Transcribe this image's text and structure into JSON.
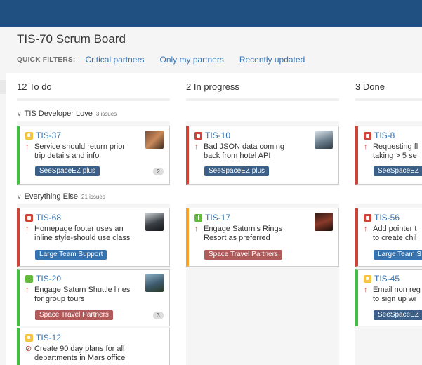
{
  "board": {
    "title": "TIS-70 Scrum Board",
    "quick_filters": {
      "label": "QUICK FILTERS:",
      "items": [
        "Critical partners",
        "Only my partners",
        "Recently updated"
      ]
    }
  },
  "columns": [
    {
      "count": "12",
      "name": "To do"
    },
    {
      "count": "2",
      "name": "In progress"
    },
    {
      "count": "3",
      "name": "Done"
    }
  ],
  "swimlanes": [
    {
      "name": "TIS Developer Love",
      "count": "3 issues"
    },
    {
      "name": "Everything Else",
      "count": "21 issues"
    }
  ],
  "cards": [
    {
      "key": "TIS-37",
      "type": "improvement-icon",
      "priority": "arrow-up-icon",
      "summary": "Service should return prior\ntrip details and info",
      "epic": "SeeSpaceEZ plus",
      "epic_color": "#3b5f86",
      "badge": "2"
    },
    {
      "key": "TIS-10",
      "type": "bug-icon",
      "priority": "arrow-up-icon",
      "summary": "Bad JSON data coming\nback from hotel API",
      "epic": "SeeSpaceEZ plus",
      "epic_color": "#3b5f86"
    },
    {
      "key": "TIS-8",
      "type": "bug-icon",
      "priority": "arrow-up-icon",
      "summary": "Requesting fl\ntaking > 5 se",
      "epic": "SeeSpaceEZ",
      "epic_color": "#3b5f86"
    },
    {
      "key": "TIS-68",
      "type": "bug-icon",
      "priority": "arrow-up-icon",
      "summary": "Homepage footer uses an\ninline style-should use class",
      "epic": "Large Team Support",
      "epic_color": "#3572b0"
    },
    {
      "key": "TIS-17",
      "type": "story-icon",
      "priority": "arrow-up-icon",
      "summary": "Engage Saturn's Rings\nResort as preferred",
      "epic": "Space Travel Partners",
      "epic_color": "#b15a5a"
    },
    {
      "key": "TIS-56",
      "type": "bug-icon",
      "priority": "arrow-up-icon",
      "summary": "Add pointer t\nto create chil",
      "epic": "Large Team S",
      "epic_color": "#3572b0"
    },
    {
      "key": "TIS-20",
      "type": "story-icon",
      "priority": "arrow-up-icon",
      "summary": "Engage Saturn Shuttle lines\nfor group tours",
      "epic": "Space Travel Partners",
      "epic_color": "#b15a5a",
      "badge": "3"
    },
    {
      "key": "TIS-45",
      "type": "improvement-icon",
      "priority": "arrow-up-icon",
      "summary": "Email non reg\nto sign up wi",
      "epic": "SeeSpaceEZ",
      "epic_color": "#3b5f86"
    },
    {
      "key": "TIS-12",
      "type": "improvement-icon",
      "priority": "blocker-icon",
      "summary": "Create 90 day plans for all\ndepartments in Mars office"
    }
  ]
}
